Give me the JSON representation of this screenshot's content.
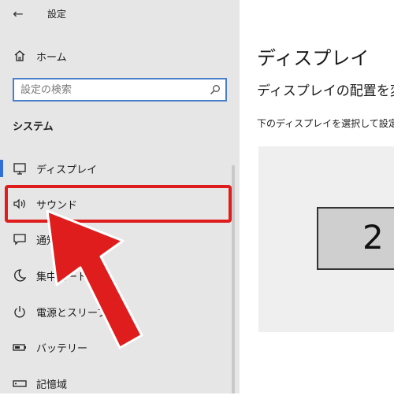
{
  "titlebar": {
    "app_title": "設定"
  },
  "nav": {
    "home_label": "ホーム",
    "search_placeholder": "設定の検索",
    "section_title": "システム",
    "items": [
      {
        "label": "ディスプレイ",
        "icon": "monitor-icon",
        "selected": true
      },
      {
        "label": "サウンド",
        "icon": "speaker-icon",
        "selected": false
      },
      {
        "label": "通知とアクション",
        "icon": "notification-icon",
        "selected": false
      },
      {
        "label": "集中モード",
        "icon": "moon-icon",
        "selected": false
      },
      {
        "label": "電源とスリープ",
        "icon": "power-icon",
        "selected": false
      },
      {
        "label": "バッテリー",
        "icon": "battery-icon",
        "selected": false
      },
      {
        "label": "記憶域",
        "icon": "storage-icon",
        "selected": false
      }
    ]
  },
  "content": {
    "page_title": "ディスプレイ",
    "sub_title": "ディスプレイの配置を変更する",
    "description": "下のディスプレイを選択して設定を変更してください。",
    "monitor_number": "2"
  },
  "colors": {
    "accent": "#2f6fd6",
    "annotation_red": "#e01d1d",
    "sidebar_bg": "#e6e6e6"
  }
}
